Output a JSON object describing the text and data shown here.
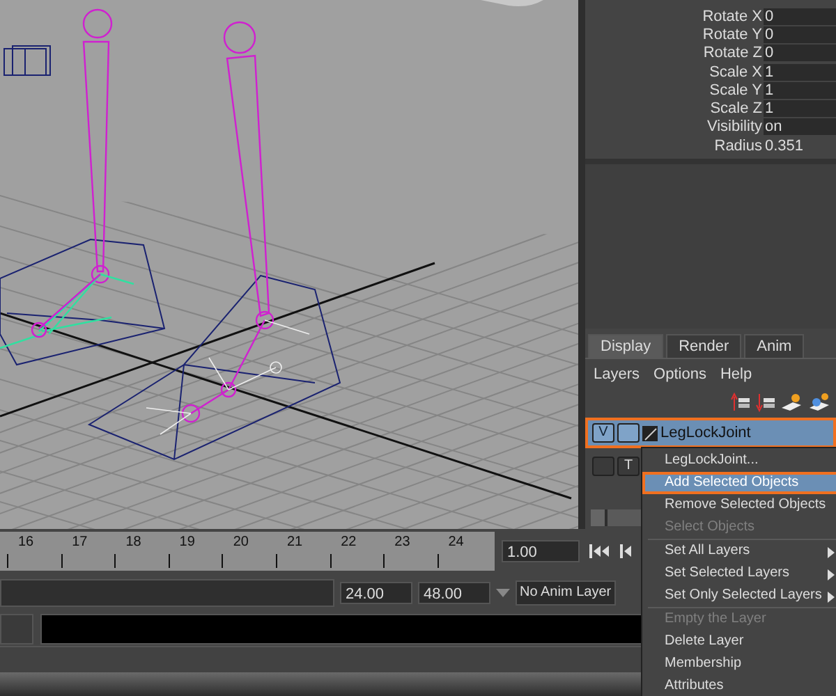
{
  "channel_box": {
    "channels": [
      {
        "name": "Rotate X",
        "value": "0",
        "kind": "field"
      },
      {
        "name": "Rotate Y",
        "value": "0",
        "kind": "field"
      },
      {
        "name": "Rotate Z",
        "value": "0",
        "kind": "field"
      },
      {
        "name": "Scale X",
        "value": "1",
        "kind": "field"
      },
      {
        "name": "Scale Y",
        "value": "1",
        "kind": "field"
      },
      {
        "name": "Scale Z",
        "value": "1",
        "kind": "field"
      },
      {
        "name": "Visibility",
        "value": "on",
        "kind": "field"
      },
      {
        "name": "Radius",
        "value": "0.351",
        "kind": "plain"
      }
    ]
  },
  "layer_editor": {
    "tabs": [
      {
        "label": "Display",
        "selected": true
      },
      {
        "label": "Render",
        "selected": false
      },
      {
        "label": "Anim",
        "selected": false
      }
    ],
    "menu": [
      "Layers",
      "Options",
      "Help"
    ],
    "layers": [
      {
        "v_toggle": "V",
        "name": "LegLockJoint",
        "selected": true,
        "highlighted": true
      },
      {
        "t_toggle": "T",
        "selected": false,
        "highlighted": false
      }
    ]
  },
  "context_menu": {
    "items": [
      {
        "kind": "item",
        "label": "LegLockJoint...",
        "disabled": false,
        "highlighted": false,
        "submenu": false
      },
      {
        "kind": "item",
        "label": "Add Selected Objects",
        "disabled": false,
        "highlighted": true,
        "submenu": false
      },
      {
        "kind": "item",
        "label": "Remove Selected Objects",
        "disabled": false,
        "highlighted": false,
        "submenu": false
      },
      {
        "kind": "item",
        "label": "Select Objects",
        "disabled": true,
        "highlighted": false,
        "submenu": false
      },
      {
        "kind": "separator"
      },
      {
        "kind": "item",
        "label": "Set All Layers",
        "disabled": false,
        "highlighted": false,
        "submenu": true
      },
      {
        "kind": "item",
        "label": "Set Selected Layers",
        "disabled": false,
        "highlighted": false,
        "submenu": true
      },
      {
        "kind": "item",
        "label": "Set Only Selected Layers",
        "disabled": false,
        "highlighted": false,
        "submenu": true
      },
      {
        "kind": "separator"
      },
      {
        "kind": "item",
        "label": "Empty the Layer",
        "disabled": true,
        "highlighted": false,
        "submenu": false
      },
      {
        "kind": "item",
        "label": "Delete Layer",
        "disabled": false,
        "highlighted": false,
        "submenu": false
      },
      {
        "kind": "item",
        "label": "Membership",
        "disabled": false,
        "highlighted": false,
        "submenu": false
      },
      {
        "kind": "item",
        "label": "Attributes",
        "disabled": false,
        "highlighted": false,
        "submenu": false
      }
    ]
  },
  "time_slider": {
    "ticks": [
      "16",
      "17",
      "18",
      "19",
      "20",
      "21",
      "22",
      "23",
      "24"
    ],
    "current_frame": "1.00"
  },
  "range_slider": {
    "end_time": "24.00",
    "max_time": "48.00",
    "anim_layer": "No Anim Layer"
  }
}
